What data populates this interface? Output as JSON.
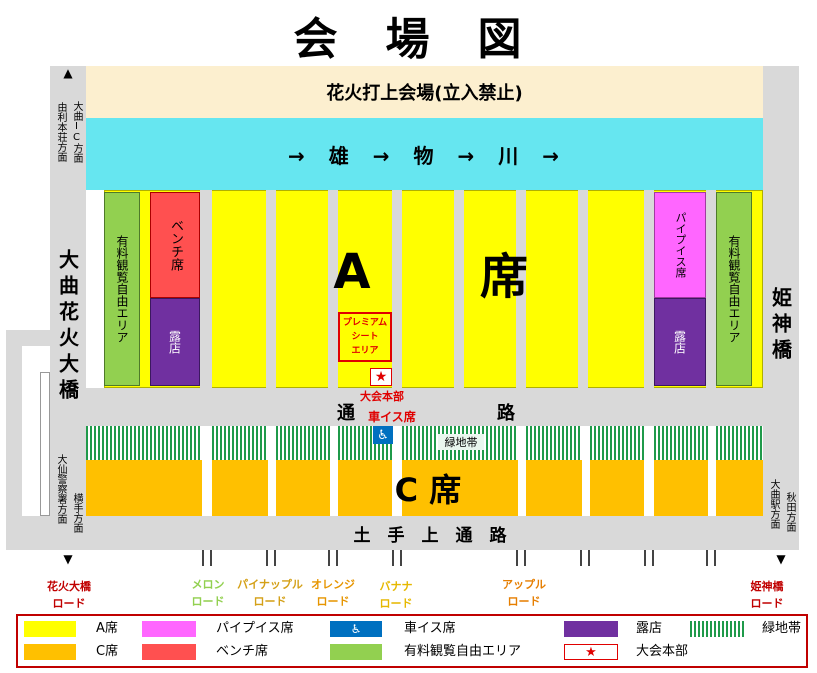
{
  "title": "会　場　図",
  "river_bank": "花火打上会場(立入禁止)",
  "river": "→　雄　→　物　→　川　→",
  "seat_a": {
    "a": "A",
    "seki": "席"
  },
  "seat_c": "C 席",
  "premium": "プレミアム\nシート\nエリア",
  "hq": "大会本部",
  "wheelchair": "車イス席",
  "greenbelt": "緑地帯",
  "tsuro_1": "通",
  "tsuro_2": "路",
  "dote_road": "土　手　上　通　路",
  "left_vertical": {
    "top_a": "大曲IC方面",
    "top_b": "由利本荘方面",
    "bridge": "大曲花火大橋",
    "bottom_a": "大仙警察署方面",
    "bottom_b": "横手方面"
  },
  "right_vertical": {
    "bridge": "姫神橋",
    "bottom_a": "大曲駅方面",
    "bottom_b": "秋田方面"
  },
  "strips": {
    "left_paid": "有料観覧自由エリア",
    "left_bench": "ベンチ席",
    "left_shop": "露店",
    "right_pipe": "パイプイス席",
    "right_shop": "露店",
    "right_paid": "有料観覧自由エリア"
  },
  "roads": [
    {
      "line1": "花火大橋",
      "line2": "ロード",
      "color": "#c00000"
    },
    {
      "line1": "メロン",
      "line2": "ロード",
      "color": "#92d050"
    },
    {
      "line1": "パイナップル",
      "line2": "ロード",
      "color": "#d4a017"
    },
    {
      "line1": "オレンジ",
      "line2": "ロード",
      "color": "#e69500"
    },
    {
      "line1": "バナナ",
      "line2": "ロード",
      "color": "#e6b800"
    },
    {
      "line1": "アップル",
      "line2": "ロード",
      "color": "#e67e00"
    },
    {
      "line1": "姫神橋",
      "line2": "ロード",
      "color": "#c00000"
    }
  ],
  "legend": {
    "a_seat": "A席",
    "pipe_seat": "パイプイス席",
    "wheelchair": "車イス席",
    "shop": "露店",
    "greenbelt": "緑地帯",
    "c_seat": "C席",
    "bench": "ベンチ席",
    "paid_area": "有料観覧自由エリア",
    "hq": "大会本部"
  },
  "icons": {
    "wheelchair": "wheelchair-icon",
    "hq": "star-icon",
    "arrow_up": "arrow-up-icon",
    "arrow_down": "arrow-down-icon"
  },
  "colors": {
    "a_seat": "#ffff00",
    "c_seat": "#ffc000",
    "pipe": "#ff66ff",
    "bench": "#ff5050",
    "shop": "#7030a0",
    "paid": "#92d050",
    "river": "#66e6f0",
    "bank": "#fcefcf",
    "road": "#d9d9d9",
    "hq_red": "#e00000",
    "wheel_blue": "#0070c0"
  }
}
